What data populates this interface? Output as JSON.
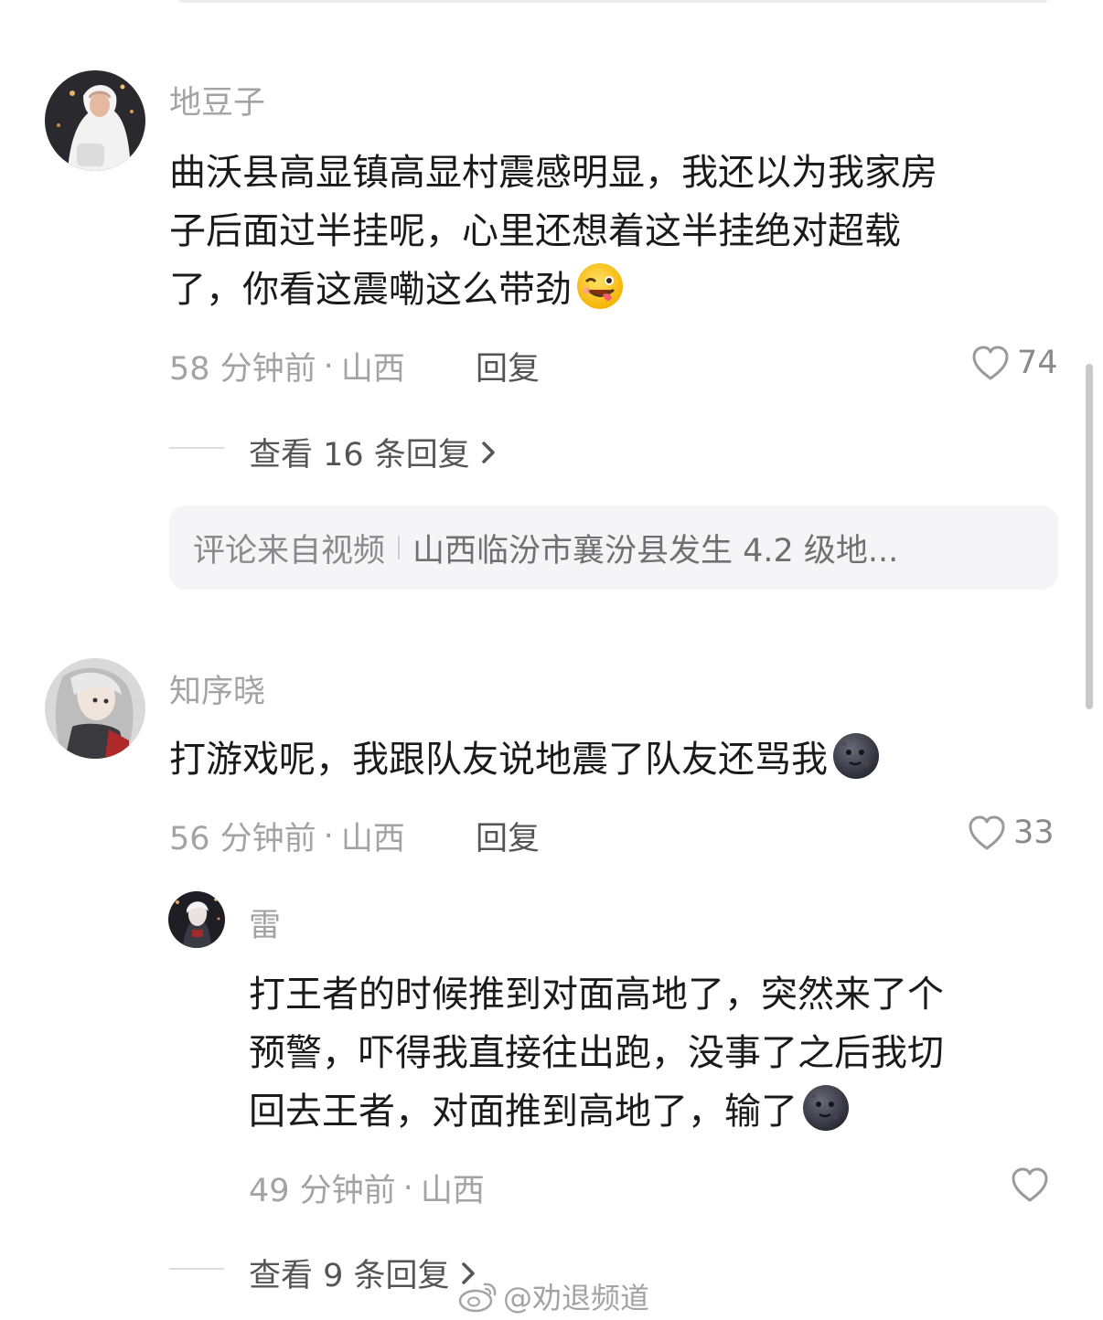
{
  "comments": [
    {
      "username": "地豆子",
      "lines": [
        "曲沃县高显镇高显村震感明显，我还以为我家房",
        "子后面过半挂呢，心里还想着这半挂绝对超载",
        "了，你看这震嘞这么带劲"
      ],
      "emoji": "winking-face-with-tongue-emoji",
      "time": "58 分钟前",
      "location": "山西",
      "reply_label": "回复",
      "likes": "74",
      "expand_label": "查看 16 条回复",
      "source": {
        "label": "评论来自视频",
        "title": "山西临汾市襄汾县发生 4.2 级地..."
      }
    },
    {
      "username": "知序晓",
      "lines": [
        "打游戏呢，我跟队友说地震了队友还骂我"
      ],
      "emoji": "new-moon-face-emoji",
      "time": "56 分钟前",
      "location": "山西",
      "reply_label": "回复",
      "likes": "33",
      "reply": {
        "username": "雷",
        "lines": [
          "打王者的时候推到对面高地了，突然来了个",
          "预警，吓得我直接往出跑，没事了之后我切",
          "回去王者，对面推到高地了，输了"
        ],
        "emoji": "new-moon-face-emoji",
        "time": "49 分钟前",
        "location": "山西"
      },
      "expand_label": "查看 9 条回复"
    }
  ],
  "watermark": "@劝退频道",
  "icons": {
    "like": "heart-outline-icon",
    "expand": "chevron-right-icon",
    "watermark": "weibo-logo-icon"
  },
  "colors": {
    "text": "#1a1a1a",
    "secondary": "#a3a3a6",
    "card_bg": "#f5f5f7"
  }
}
